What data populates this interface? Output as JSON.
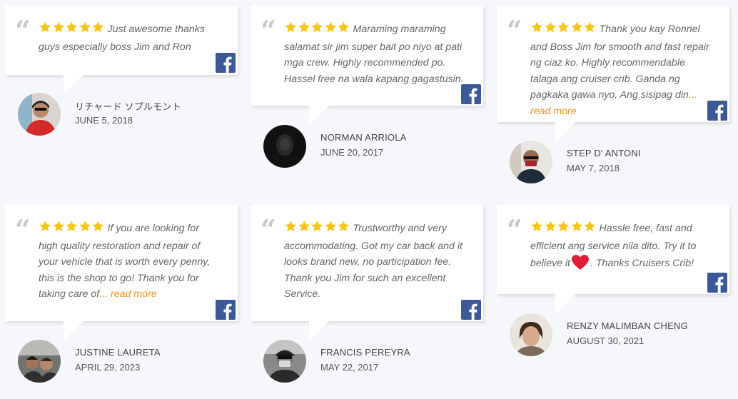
{
  "colors": {
    "accent": "#f0911e",
    "star": "#f5c518",
    "facebook": "#3b5998",
    "quote": "#c9c9c9",
    "heart": "#e01e37"
  },
  "reviews": [
    {
      "text": "Just awesome thanks guys especially boss Jim and Ron",
      "read_more": "",
      "name": "リチャード ソプルモント",
      "date": "JUNE 5, 2018",
      "rating": 5
    },
    {
      "text": "Maraming maraming salamat sir jim super bait po niyo at pati mga crew. Highly recommended po. Hassel free na wala kapang gagastusin.",
      "read_more": "",
      "name": "NORMAN ARRIOLA",
      "date": "JUNE 20, 2017",
      "rating": 5
    },
    {
      "text": "Thank you kay Ronnel and Boss Jim for smooth and fast repair ng ciaz ko. Highly recommendable talaga ang cruiser crib. Ganda ng pagkaka gawa nyo. Ang sisipag din",
      "read_more": "... read more",
      "name": "STEP D' ANTONI",
      "date": "MAY 7, 2018",
      "rating": 5
    },
    {
      "text": "If you are looking for high quality restoration and repair of your vehicle that is worth every penny, this is the shop to go! Thank you for taking care of",
      "read_more": "... read more",
      "name": "JUSTINE LAURETA",
      "date": "APRIL 29, 2023",
      "rating": 5
    },
    {
      "text": "Trustworthy and very accommodating. Got my car back and it looks brand new, no participation fee. Thank you Jim for such an excellent Service.",
      "read_more": "",
      "name": "FRANCIS PEREYRA",
      "date": "MAY 22, 2017",
      "rating": 5
    },
    {
      "text": "Hassle free, fast and efficient ang service nila dito. Try it to believe it",
      "text_after": ". Thanks Cruisers Crib!",
      "read_more": "",
      "name": "RENZY MALIMBAN CHENG",
      "date": "AUGUST 30, 2021",
      "rating": 5
    }
  ],
  "icons": {
    "quote": "quote-icon",
    "star": "star-icon",
    "facebook": "facebook-icon",
    "heart": "heart-icon"
  }
}
